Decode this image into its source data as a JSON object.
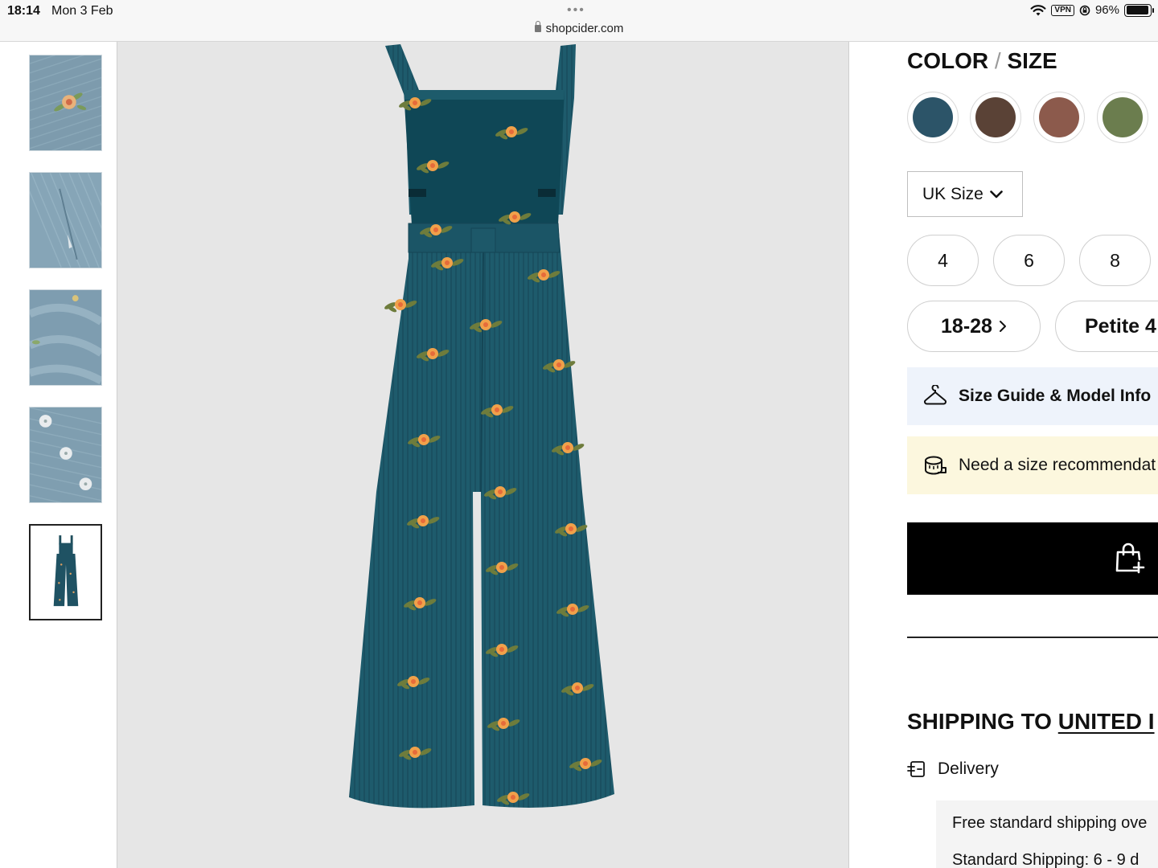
{
  "status_bar": {
    "time": "18:14",
    "date": "Mon 3 Feb",
    "url": "shopcider.com",
    "vpn_label": "VPN",
    "battery": "96%",
    "battery_level": 0.96
  },
  "thumbnails": [
    {
      "name": "floral-embroidery-detail"
    },
    {
      "name": "pocket-detail"
    },
    {
      "name": "corduroy-texture-detail"
    },
    {
      "name": "button-detail"
    },
    {
      "name": "full-back-view",
      "selected": true
    }
  ],
  "product": {
    "main_image": "teal-corduroy-floral-overalls-back-view",
    "fabric_color": "#1f5a6b"
  },
  "options": {
    "title_color": "COLOR",
    "title_sep": "/",
    "title_size": "SIZE",
    "colors": [
      {
        "name": "teal",
        "hex": "#2c5468"
      },
      {
        "name": "brown",
        "hex": "#5a4236"
      },
      {
        "name": "rust",
        "hex": "#8c5a4c"
      },
      {
        "name": "olive",
        "hex": "#6b7d4e"
      }
    ],
    "size_system": "UK Size",
    "sizes": [
      "4",
      "6",
      "8"
    ],
    "size_ranges": [
      "18-28",
      "Petite 4"
    ]
  },
  "size_guide": {
    "label": "Size Guide & Model Info"
  },
  "size_recommendation": {
    "label": "Need a size recommendat"
  },
  "shipping": {
    "title_prefix": "SHIPPING TO",
    "country": "UNITED I",
    "delivery_label": "Delivery",
    "lines": [
      "Free standard shipping ove",
      "Standard Shipping: 6 - 9 d"
    ]
  }
}
